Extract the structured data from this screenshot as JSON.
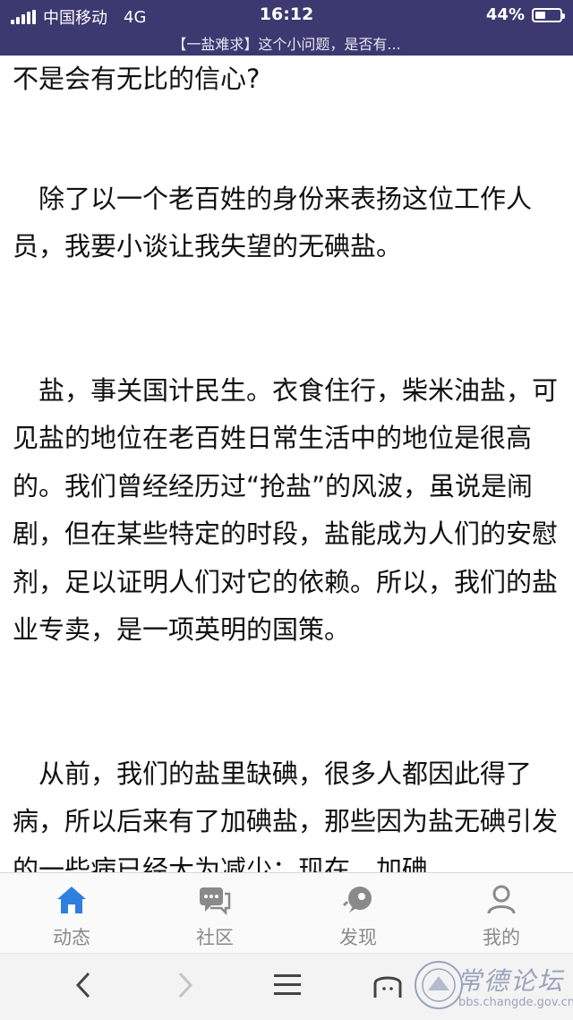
{
  "status_bar": {
    "carrier": "中国移动",
    "network": "4G",
    "time": "16:12",
    "battery": "44%",
    "battery_level": 0.44,
    "page_title": "【一盐难求】这个小问题，是否有..."
  },
  "article": {
    "p1": "不是会有无比的信心?",
    "p2": "除了以一个老百姓的身份来表扬这位工作人员，我要小谈让我失望的无碘盐。",
    "p3": "盐，事关国计民生。衣食住行，柴米油盐，可见盐的地位在老百姓日常生活中的地位是很高的。我们曾经经历过“抢盐”的风波，虽说是闹剧，但在某些特定的时段，盐能成为人们的安慰剂，足以证明人们对它的依赖。所以，我们的盐业专卖，是一项英明的国策。",
    "p4": "从前，我们的盐里缺碘，很多人都因此得了病，所以后来有了加碘盐，那些因为盐无碘引发的一些病已经大为减少；现在，加碘"
  },
  "tabbar": {
    "tabs": [
      {
        "label": "动态",
        "icon": "home-icon"
      },
      {
        "label": "社区",
        "icon": "chat-icon"
      },
      {
        "label": "发现",
        "icon": "rocket-icon"
      },
      {
        "label": "我的",
        "icon": "user-icon"
      }
    ]
  },
  "watermark": {
    "text": "常德论坛",
    "url": "bbs.changde.gov.cn"
  },
  "colors": {
    "status_bg": "#3c3870",
    "accent": "#2f7fe0",
    "tab_icon": "#8a8a8a"
  }
}
